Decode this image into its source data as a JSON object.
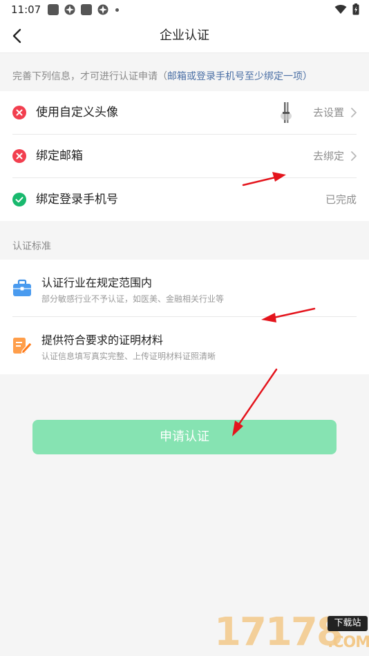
{
  "status_bar": {
    "time": "11:07"
  },
  "nav": {
    "title": "企业认证"
  },
  "notice": {
    "prefix": "完善下列信息，才可进行认证申请（",
    "link": "邮箱或登录手机号至少绑定一项",
    "suffix": "）"
  },
  "requirements": [
    {
      "label": "使用自定义头像",
      "action": "去设置",
      "status": "incomplete"
    },
    {
      "label": "绑定邮箱",
      "action": "去绑定",
      "status": "incomplete"
    },
    {
      "label": "绑定登录手机号",
      "action": "已完成",
      "status": "complete"
    }
  ],
  "standards": {
    "title": "认证标准",
    "items": [
      {
        "title": "认证行业在规定范围内",
        "subtitle": "部分敏感行业不予认证，如医美、金融相关行业等",
        "icon": "briefcase-icon"
      },
      {
        "title": "提供符合要求的证明材料",
        "subtitle": "认证信息填写真实完整、上传证明材料证照清晰",
        "icon": "document-edit-icon"
      }
    ]
  },
  "apply_button": {
    "label": "申请认证"
  },
  "watermark": {
    "digits": "17178",
    "tag": "下载站",
    "domain": ".COM"
  },
  "colors": {
    "accent_disabled": "#86e3b2",
    "error": "#f23f4f",
    "success": "#19b96e",
    "link": "#4a6fa5",
    "arrow": "#e4141c"
  }
}
